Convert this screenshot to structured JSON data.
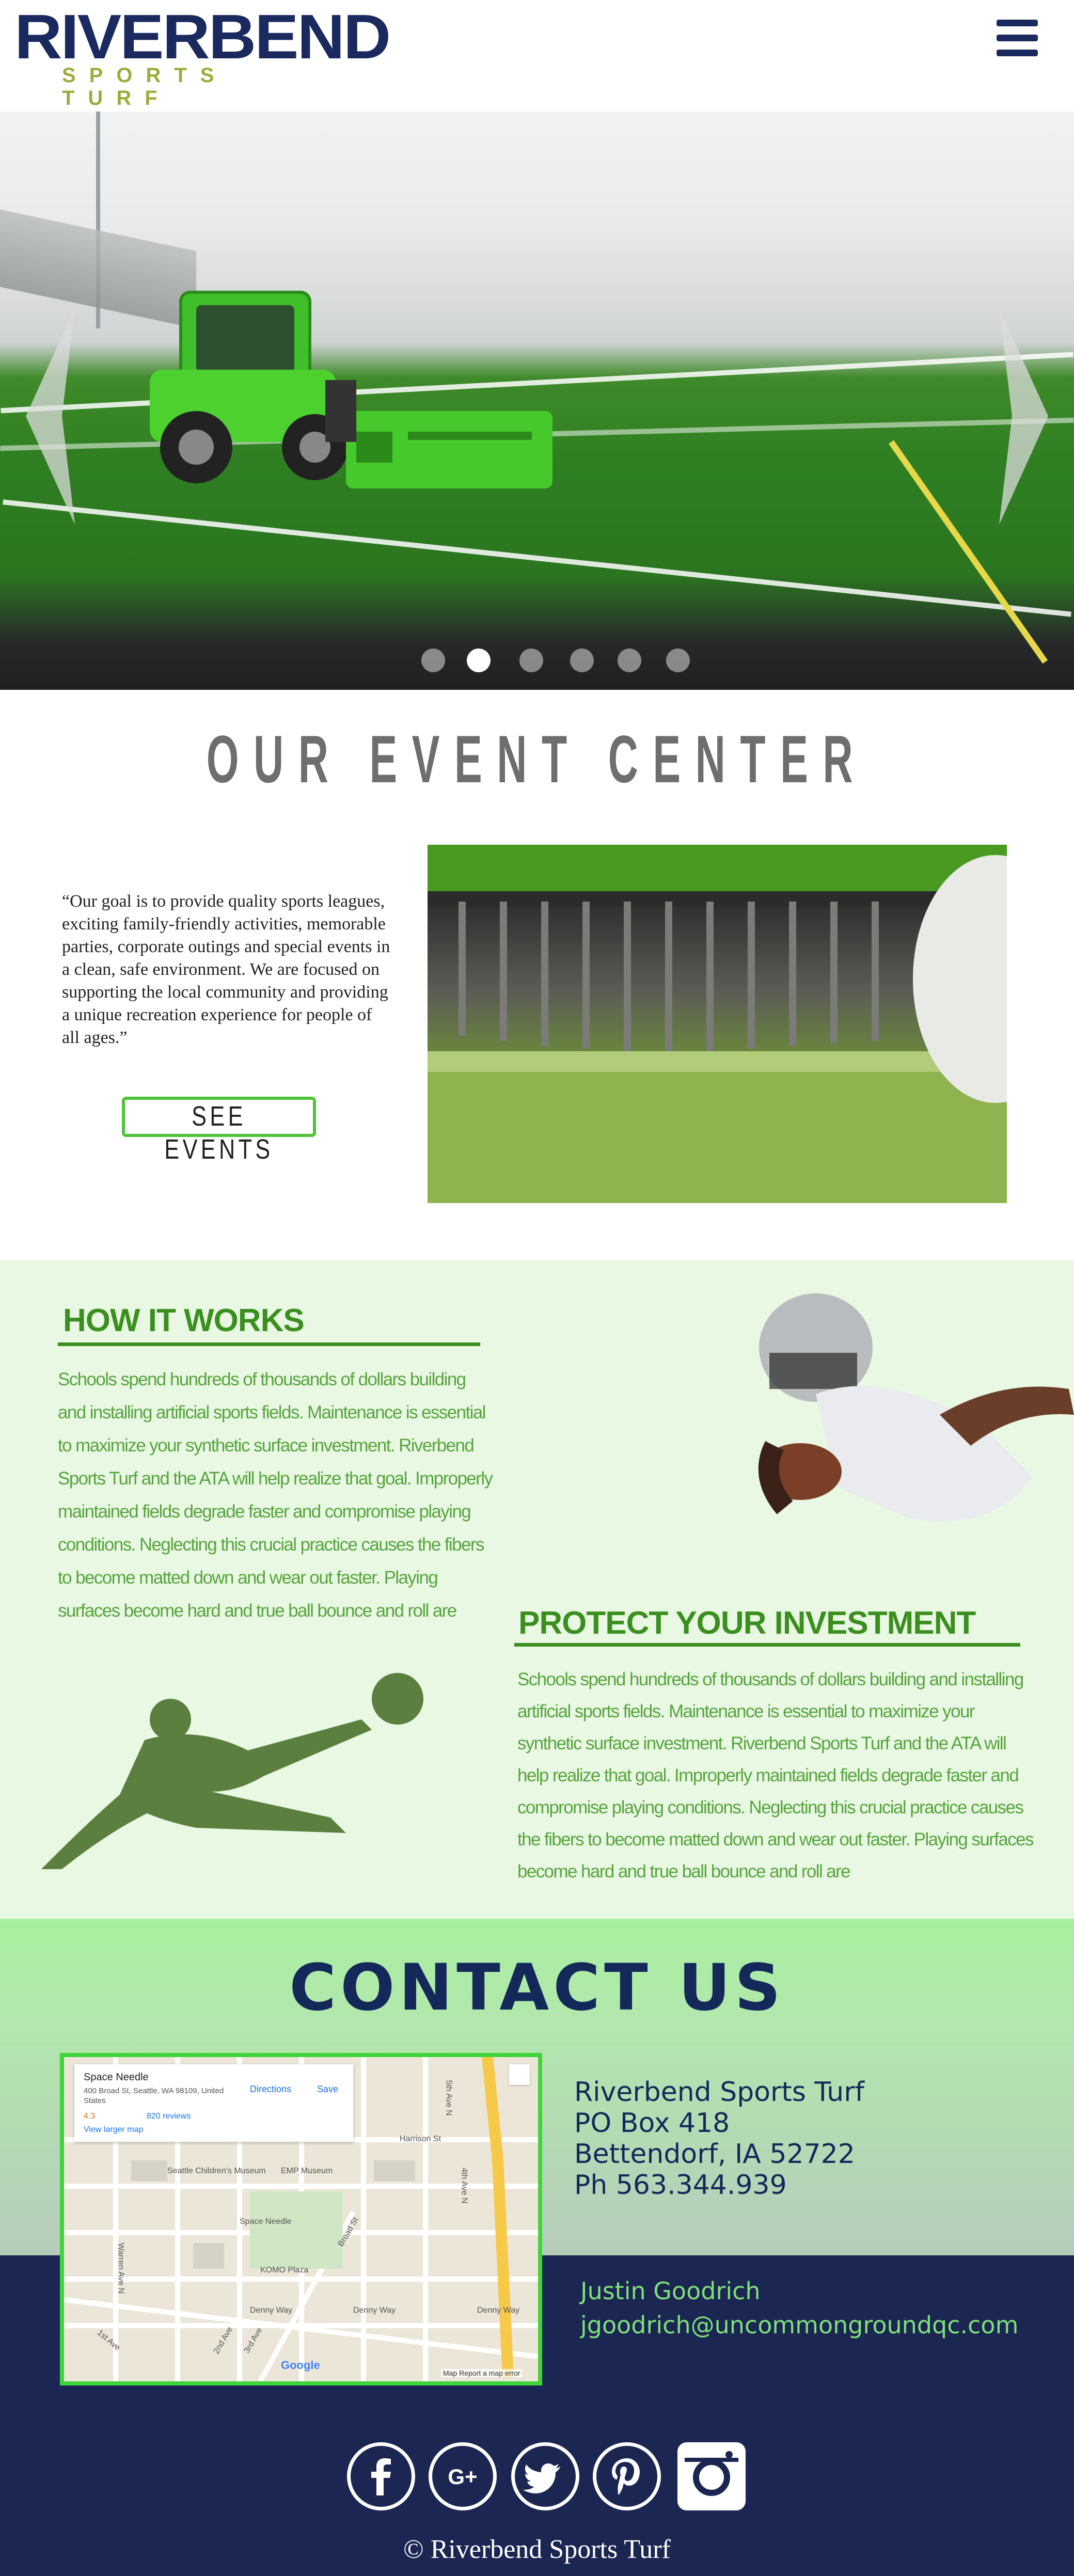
{
  "header": {
    "logo_main": "RIVERBEND",
    "logo_sub": "SPORTS TURF",
    "menu_icon": "hamburger-menu-icon"
  },
  "hero": {
    "slide_count": 6,
    "active_slide": 2,
    "prev_icon": "chevron-left-icon",
    "next_icon": "chevron-right-icon"
  },
  "event_center": {
    "title": "OUR EVENT  CENTER",
    "quote": "“Our goal is to provide quality sports leagues, exciting family-friendly activities, memorable parties, corporate outings and special events in a clean, safe environment. We are focused on supporting the local community and providing a unique recreation experience for people of all ages.”",
    "button_label": "SEE EVENTS"
  },
  "how_it_works": {
    "title": "HOW IT WORKS",
    "body": "Schools spend hundreds of thousands of dollars building and installing artificial sports fields. Maintenance is essential to maximize your synthetic surface investment. Riverbend Sports Turf and the ATA will help realize that goal. Improperly maintained fields degrade faster and compromise playing conditions. Neglecting this crucial practice causes the fibers to become matted down and wear out faster. Playing surfaces become hard and true ball bounce and roll are"
  },
  "protect": {
    "title": "PROTECT YOUR INVESTMENT",
    "body": "Schools spend hundreds of thousands of dollars building and installing artificial sports fields. Maintenance is essential to maximize your synthetic surface investment. Riverbend Sports Turf and the ATA will help realize that goal. Improperly maintained fields degrade faster and compromise playing conditions. Neglecting this crucial practice causes the fibers to become matted down and wear out faster. Playing surfaces become hard and true ball bounce and roll are"
  },
  "contact": {
    "title": "CONTACT  US",
    "company": "Riverbend Sports Turf",
    "po_box": "PO Box 418",
    "city": "Bettendorf, IA 52722",
    "phone": "Ph 563.344.939",
    "person_name": "Justin Goodrich",
    "email": "jgoodrich@uncommongroundqc.com"
  },
  "map": {
    "place": "Space Needle",
    "address": "400 Broad St, Seattle, WA 98109, United States",
    "directions": "Directions",
    "save": "Save",
    "rating": "4.3",
    "reviews": "820 reviews",
    "larger_map": "View larger map",
    "labels": [
      "Harrison St",
      "5th Ave N",
      "Seattle Children's Museum",
      "EMP Museum",
      "Space Needle",
      "KOMO Plaza",
      "Denny Way",
      "Denny Way",
      "Denny Way",
      "Warren Ave N",
      "Broad St",
      "1st Ave",
      "2nd Ave",
      "3rd Ave",
      "4th Ave N"
    ],
    "google": "Google",
    "footer": "Map  Report a map error"
  },
  "footer": {
    "socials": [
      "facebook-icon",
      "google-plus-icon",
      "twitter-icon",
      "pinterest-icon",
      "instagram-icon"
    ],
    "copyright": "© Riverbend Sports Turf"
  },
  "colors": {
    "navy": "#1b2652",
    "brand_green": "#3b8f1f",
    "light_green": "#e8f8e3",
    "button_border": "#4fc23a"
  }
}
